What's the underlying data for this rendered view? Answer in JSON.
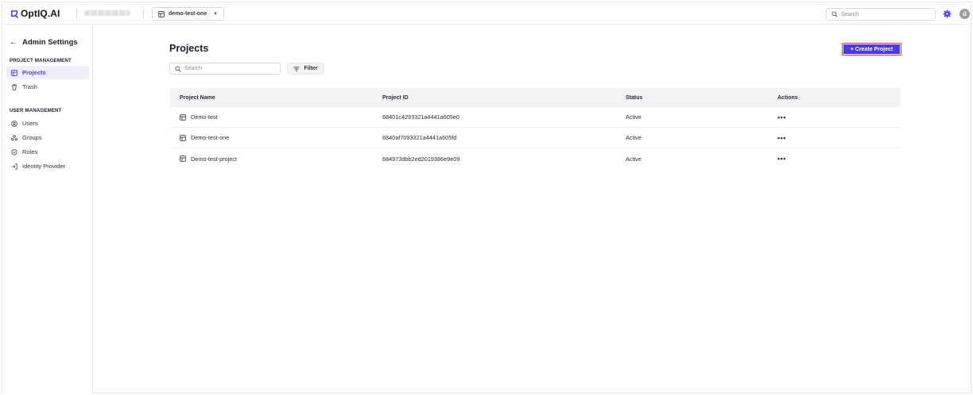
{
  "app": {
    "logo_text": "OptIQ.AI"
  },
  "topbar": {
    "project_selector": {
      "value": "demo-test-one"
    },
    "search": {
      "placeholder": "Search"
    },
    "avatar_initial": "d"
  },
  "sidebar": {
    "back_label": "Admin Settings",
    "sections": [
      {
        "title": "PROJECT MANAGEMENT",
        "items": [
          {
            "label": "Projects",
            "icon": "project-icon",
            "active": true
          },
          {
            "label": "Trash",
            "icon": "trash-icon",
            "active": false
          }
        ]
      },
      {
        "title": "USER MANAGEMENT",
        "items": [
          {
            "label": "Users",
            "icon": "user-icon",
            "active": false
          },
          {
            "label": "Groups",
            "icon": "groups-icon",
            "active": false
          },
          {
            "label": "Roles",
            "icon": "shield-icon",
            "active": false
          },
          {
            "label": "Identity Provider",
            "icon": "login-icon",
            "active": false
          }
        ]
      }
    ]
  },
  "main": {
    "title": "Projects",
    "create_button": "+ Create Project",
    "search": {
      "placeholder": "Search"
    },
    "filter_label": "Filter",
    "table": {
      "headers": [
        "Project Name",
        "Project ID",
        "Status",
        "Actions"
      ],
      "rows": [
        {
          "name": "Demo-test",
          "id": "68401c4293321a4441a605e0",
          "status": "Active",
          "actions": "•••"
        },
        {
          "name": "Demo-test-one",
          "id": "6840af7093321a4441a605fd",
          "status": "Active",
          "actions": "•••"
        },
        {
          "name": "Demo-test-project",
          "id": "684973dbb2ed2019386e9e09",
          "status": "Active",
          "actions": "•••"
        }
      ]
    }
  },
  "colors": {
    "accent": "#4b38e6",
    "highlight_border": "#e0312b",
    "active_bg": "#efeefa"
  }
}
